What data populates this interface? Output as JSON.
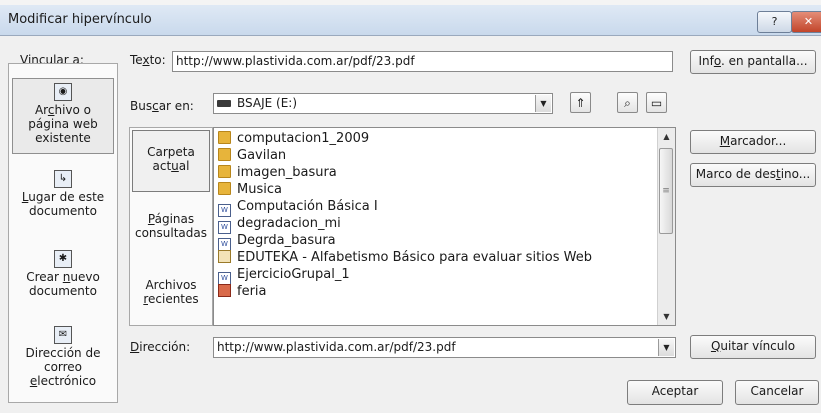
{
  "window": {
    "title": "Modificar hipervínculo",
    "help_glyph": "?",
    "close_glyph": "✕"
  },
  "link_to": {
    "label": "Vincular a:",
    "items": [
      {
        "pre": "Ar",
        "key": "c",
        "post": "hivo o página web existente",
        "icon": "globe-page-icon"
      },
      {
        "pre": "",
        "key": "L",
        "post": "ugar de este documento",
        "icon": "document-place-icon"
      },
      {
        "pre": "Crear ",
        "key": "n",
        "post": "uevo documento",
        "icon": "new-document-icon"
      },
      {
        "pre": "Dirección de correo ",
        "key": "e",
        "post": "lectrónico",
        "icon": "email-icon"
      }
    ]
  },
  "text_row": {
    "label_pre": "Te",
    "label_key": "x",
    "label_post": "to:",
    "value": "http://www.plastivida.com.ar/pdf/23.pdf",
    "screen_tip_pre": "Inf",
    "screen_tip_key": "o",
    "screen_tip_post": ". en pantalla..."
  },
  "look_in": {
    "label_pre": "Bus",
    "label_key": "c",
    "label_post": "ar en:",
    "value": "BSAJE (E:)"
  },
  "nav": [
    {
      "pre": "Carpeta act",
      "key": "u",
      "post": "al"
    },
    {
      "pre": "",
      "key": "P",
      "post": "áginas consultadas"
    },
    {
      "pre": "Archivos ",
      "key": "r",
      "post": "ecientes"
    }
  ],
  "files": [
    {
      "name": "computacion1_2009",
      "kind": "folder"
    },
    {
      "name": "Gavilan",
      "kind": "folder"
    },
    {
      "name": "imagen_basura",
      "kind": "folder"
    },
    {
      "name": "Musica",
      "kind": "folder"
    },
    {
      "name": "Computación Básica I",
      "kind": "doc"
    },
    {
      "name": "degradacion_mi",
      "kind": "doc"
    },
    {
      "name": "Degrda_basura",
      "kind": "doc"
    },
    {
      "name": "EDUTEKA - Alfabetismo Básico para evaluar sitios Web",
      "kind": "web"
    },
    {
      "name": "EjercicioGrupal_1",
      "kind": "doc"
    },
    {
      "name": "feria",
      "kind": "img"
    }
  ],
  "side_buttons": {
    "bookmark_key": "M",
    "bookmark_post": "arcador...",
    "frame_pre": "Marco de des",
    "frame_key": "t",
    "frame_post": "ino..."
  },
  "address": {
    "label_key": "D",
    "label_post": "irección:",
    "value": "http://www.plastivida.com.ar/pdf/23.pdf",
    "remove_key": "Q",
    "remove_post": "uitar vínculo"
  },
  "footer": {
    "ok": "Aceptar",
    "cancel": "Cancelar"
  }
}
